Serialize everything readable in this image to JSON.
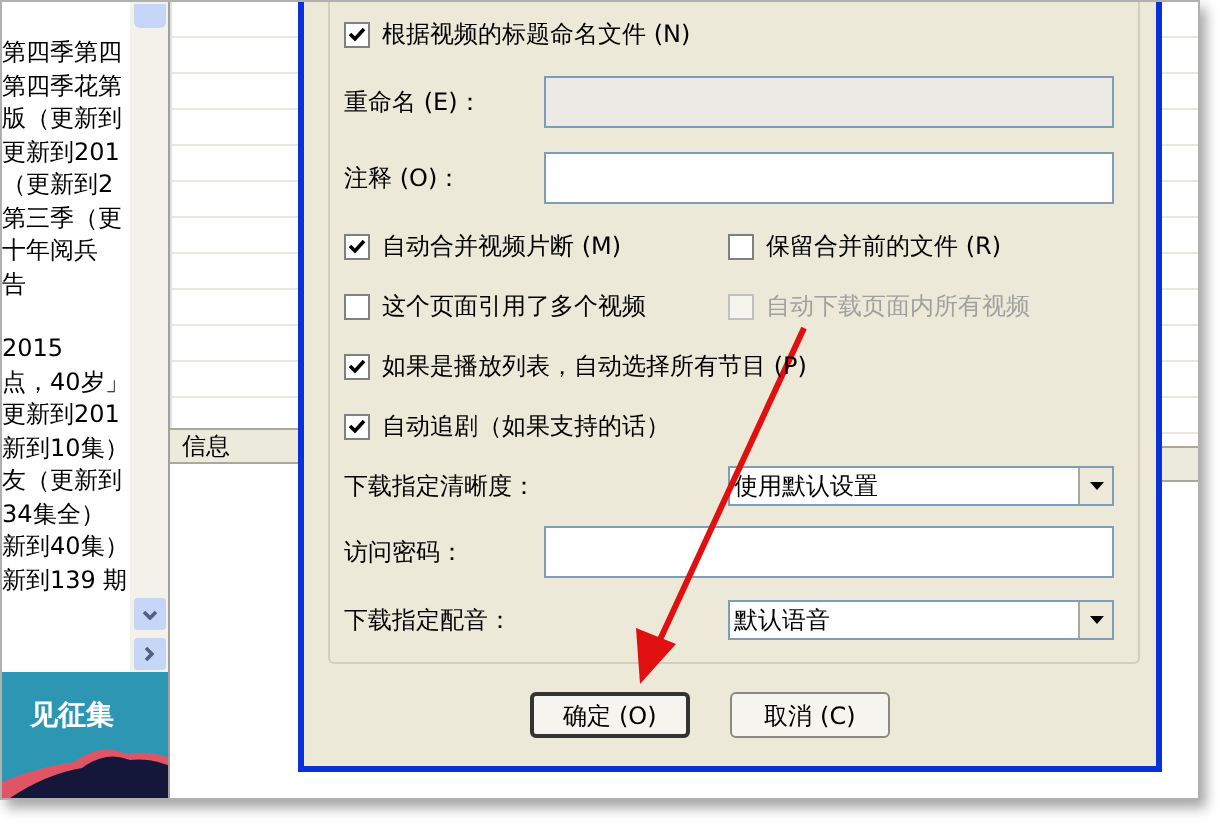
{
  "left_list": {
    "groups": [
      [
        "第四季第四",
        "第四季花第",
        "版（更新到",
        "更新到201",
        "（更新到2",
        "第三季（更",
        "十年阅兵",
        "告"
      ],
      [
        "2015",
        "点，40岁」",
        "更新到201",
        "新到10集）",
        "友（更新到",
        "34集全）",
        "新到40集）",
        "新到139 期"
      ]
    ]
  },
  "banner": {
    "text": "见征集"
  },
  "info_panel": {
    "header": "信息"
  },
  "dialog": {
    "rows": [
      {
        "kind": "checkbox",
        "items": [
          {
            "label": "根据视频的标题命名文件 (N)",
            "checked": true,
            "disabled": false
          }
        ]
      },
      {
        "kind": "field",
        "label": "重命名 (E)：",
        "disabled": true
      },
      {
        "kind": "field",
        "label": "注释 (O)：",
        "disabled": false
      },
      {
        "kind": "checkbox",
        "items": [
          {
            "label": "自动合并视频片断 (M)",
            "checked": true,
            "disabled": false
          },
          {
            "label": "保留合并前的文件 (R)",
            "checked": false,
            "disabled": false
          }
        ]
      },
      {
        "kind": "checkbox",
        "items": [
          {
            "label": "这个页面引用了多个视频",
            "checked": false,
            "disabled": false
          },
          {
            "label": "自动下载页面内所有视频",
            "checked": false,
            "disabled": true
          }
        ]
      },
      {
        "kind": "checkbox",
        "items": [
          {
            "label": "如果是播放列表，自动选择所有节目 (P)",
            "checked": true,
            "disabled": false
          }
        ]
      },
      {
        "kind": "checkbox",
        "items": [
          {
            "label": "自动追剧（如果支持的话）",
            "checked": true,
            "disabled": false
          }
        ]
      },
      {
        "kind": "dropdown",
        "label": "下载指定清晰度：",
        "value": "使用默认设置"
      },
      {
        "kind": "field",
        "label": "访问密码：",
        "disabled": false
      },
      {
        "kind": "dropdown",
        "label": "下载指定配音：",
        "value": "默认语音"
      }
    ],
    "buttons": [
      {
        "label": "确定 (O)",
        "default": true
      },
      {
        "label": "取消 (C)",
        "default": false
      }
    ]
  }
}
